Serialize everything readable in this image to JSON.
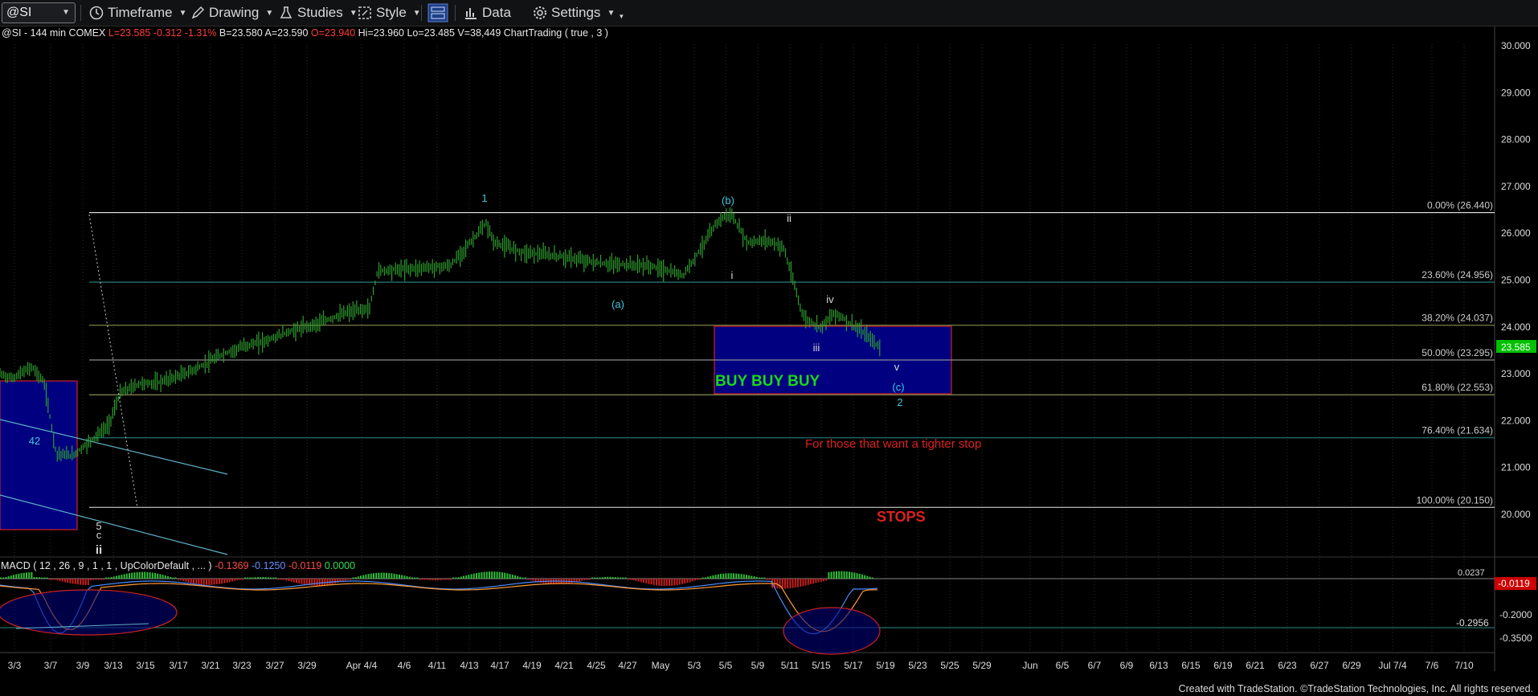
{
  "toolbar": {
    "symbol": "@SI",
    "timeframe": "Timeframe",
    "drawing": "Drawing",
    "studies": "Studies",
    "style": "Style",
    "data": "Data",
    "settings": "Settings"
  },
  "info": {
    "symbol": "@SI - 144 min  COMEX",
    "last": "L=23.585",
    "change": "-0.312",
    "change_pct": "-1.31%",
    "bid": "B=23.580",
    "ask": "A=23.590",
    "open": "O=23.940",
    "high": "Hi=23.960",
    "low": "Lo=23.485",
    "volume": "V=38,449",
    "study": "ChartTrading ( true , 3 )"
  },
  "price_axis": {
    "ticks": [
      "30.000",
      "29.000",
      "28.000",
      "27.000",
      "26.000",
      "25.000",
      "24.000",
      "23.000",
      "22.000",
      "21.000",
      "20.000"
    ],
    "current_price": "23.585",
    "current_price_color": "#00c000"
  },
  "fib_levels": [
    {
      "label": "0.00% (26.440)",
      "price": 26.44,
      "color": "#e8e8e8"
    },
    {
      "label": "23.60% (24.956)",
      "price": 24.956,
      "color": "#2a8a8a"
    },
    {
      "label": "38.20% (24.037)",
      "price": 24.037,
      "color": "#8a8a4a"
    },
    {
      "label": "50.00% (23.295)",
      "price": 23.295,
      "color": "#9a9a9a"
    },
    {
      "label": "61.80% (22.553)",
      "price": 22.553,
      "color": "#9a9a5a"
    },
    {
      "label": "76.40% (21.634)",
      "price": 21.634,
      "color": "#2a8a8a"
    },
    {
      "label": "100.00% (20.150)",
      "price": 20.15,
      "color": "#e8e8e8"
    }
  ],
  "wave_labels": [
    {
      "text": "1",
      "color": "#40c8d8"
    },
    {
      "text": "(b)",
      "color": "#40c8d8"
    },
    {
      "text": "ii",
      "color": "#d8d8d8"
    },
    {
      "text": "i",
      "color": "#d8d8d8"
    },
    {
      "text": "iv",
      "color": "#d8d8d8"
    },
    {
      "text": "(a)",
      "color": "#40c8d8"
    },
    {
      "text": "iii",
      "color": "#d8d8d8"
    },
    {
      "text": "v",
      "color": "#d8d8d8"
    },
    {
      "text": "(c)",
      "color": "#40c8d8"
    },
    {
      "text": "2",
      "color": "#40c8d8"
    },
    {
      "text": "42",
      "color": "#40c8d8"
    },
    {
      "text": "5",
      "color": "#d8d8d8"
    },
    {
      "text": "c",
      "color": "#d8d8d8"
    },
    {
      "text": "ii",
      "color": "#d8d8d8"
    }
  ],
  "annotations": {
    "buy": "BUY BUY BUY",
    "tighter_stop": "For those that want a tighter stop",
    "stops": "STOPS"
  },
  "macd": {
    "label": "MACD ( 12 , 26 , 9 , 1 , 1 , UpColorDefault , ... )",
    "v1": "-0.1369",
    "v2": "-0.1250",
    "v3": "-0.0119",
    "v4": "0.0000",
    "axis_ticks": [
      "-0.2000",
      "-0.3500"
    ],
    "level_label": "-0.2956",
    "current": "-0.0119",
    "top_label": "0.0237"
  },
  "date_axis": [
    "3/3",
    "3/7",
    "3/9",
    "3/13",
    "3/15",
    "3/17",
    "3/21",
    "3/23",
    "3/27",
    "3/29",
    "Apr 4/4",
    "4/6",
    "4/11",
    "4/13",
    "4/17",
    "4/19",
    "4/21",
    "4/25",
    "4/27",
    "May",
    "5/3",
    "5/5",
    "5/9",
    "5/11",
    "5/15",
    "5/17",
    "5/19",
    "5/23",
    "5/25",
    "5/29",
    "Jun",
    "6/5",
    "6/7",
    "6/9",
    "6/13",
    "6/15",
    "6/19",
    "6/21",
    "6/23",
    "6/27",
    "6/29",
    "Jul 7/4",
    "7/6",
    "7/10"
  ],
  "footer": "Created with TradeStation. ©TradeStation Technologies, Inc. All rights reserved."
}
